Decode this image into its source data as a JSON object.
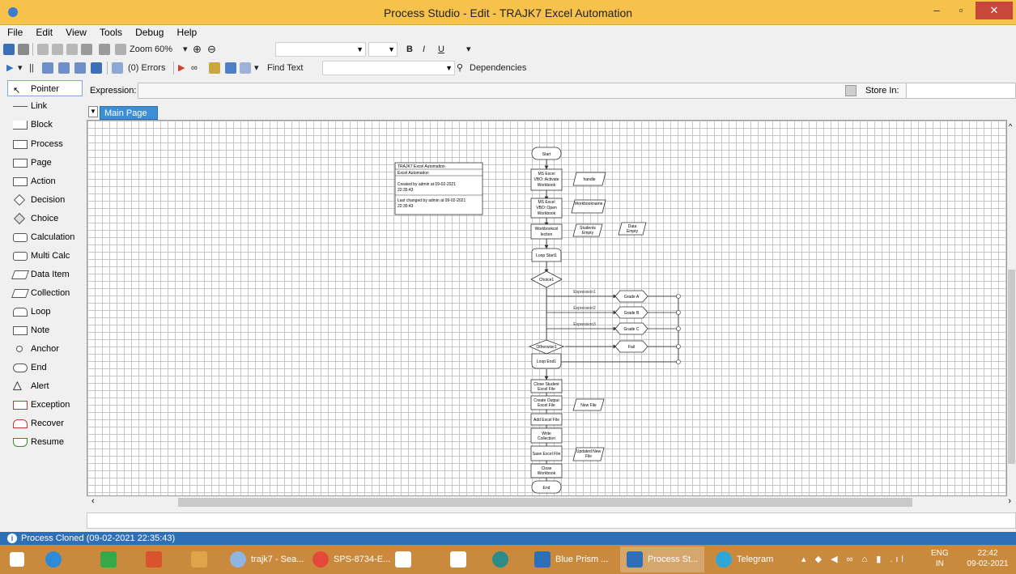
{
  "window": {
    "title": "Process Studio  - Edit - TRAJK7 Excel Automation",
    "minimize": "–",
    "maximize": "▫",
    "close": "✕"
  },
  "menu": [
    "File",
    "Edit",
    "View",
    "Tools",
    "Debug",
    "Help"
  ],
  "toolbar1": {
    "zoom_label": "Zoom",
    "zoom_value": "60%",
    "bold": "B",
    "italic": "I",
    "underline": "U"
  },
  "toolbar2": {
    "errors": "(0) Errors",
    "find_text": "Find Text",
    "dependencies": "Dependencies"
  },
  "palette": [
    "Pointer",
    "Link",
    "Block",
    "Process",
    "Page",
    "Action",
    "Decision",
    "Choice",
    "Calculation",
    "Multi Calc",
    "Data Item",
    "Collection",
    "Loop",
    "Note",
    "Anchor",
    "End",
    "Alert",
    "Exception",
    "Recover",
    "Resume"
  ],
  "expression": {
    "label": "Expression:",
    "store_in": "Store In:"
  },
  "tabs": {
    "main": "Main Page"
  },
  "diagram": {
    "info_box": [
      "TRAJK7 Excel Automation",
      "Excel Automation",
      "Created by admin at 09-02-2021",
      "22:35:43",
      "Last changed by admin at 09-02-2021",
      "22:35:43"
    ],
    "start": "Start",
    "activate": [
      "MS Excel",
      "VBO::Activate",
      "Workbook"
    ],
    "handle": "handle",
    "open": [
      "MS Excel",
      "VBO::Open",
      "Workbook"
    ],
    "workbookname": "Workbookname",
    "workbook_collection": [
      "Workbookcol",
      "lection"
    ],
    "students_empty": [
      "Students",
      "Empty"
    ],
    "data_empty": [
      "Data",
      "Empty"
    ],
    "loop_start": "Loop Start1",
    "choice": "Choice1",
    "expressions": [
      "Expression1",
      "Expression2",
      "Expression3"
    ],
    "grades": [
      "Grade A",
      "Grade B",
      "Grade C",
      "Fail"
    ],
    "otherwise": "Otherwise1",
    "loop_end": "Loop End1",
    "close_student": [
      "Close Student",
      "Excel File"
    ],
    "create_output": [
      "Create Output",
      "Excel File"
    ],
    "new_file": "New File",
    "add_excel": "Add Excel File",
    "write": [
      "Write",
      "Collection"
    ],
    "save_excel": "Save Excel File",
    "updated_new": [
      "Updated New",
      "File"
    ],
    "close_workbook": [
      "Close",
      "Workbook"
    ],
    "end": "End"
  },
  "status": {
    "message": "Process Cloned (09-02-2021 22:35:43)"
  },
  "taskbar": {
    "items": [
      "trajk7 - Sea...",
      "SPS-8734-E...",
      "Blue Prism ...",
      "Process St...",
      "Telegram"
    ],
    "lang": "ENG",
    "region": "IN",
    "time": "22:42",
    "date": "09-02-2021"
  }
}
